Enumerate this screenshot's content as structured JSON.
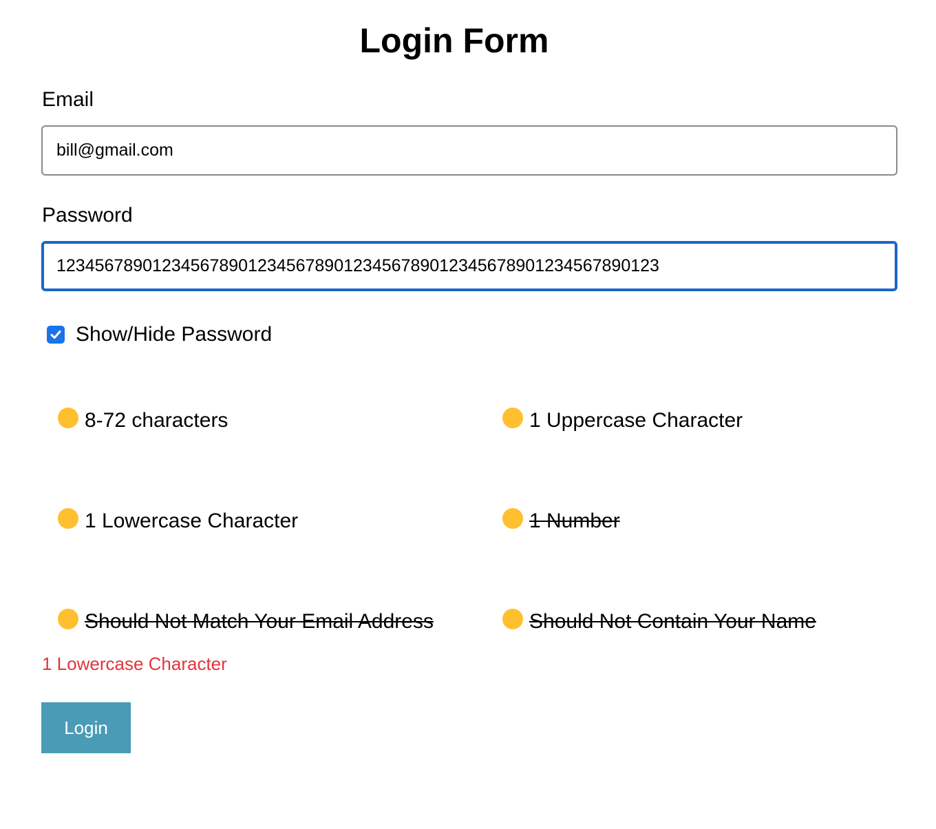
{
  "header": {
    "title": "Login Form"
  },
  "form": {
    "email": {
      "label": "Email",
      "value": "bill@gmail.com"
    },
    "password": {
      "label": "Password",
      "value": "123456789012345678901234567890123456789012345678901234567890123"
    },
    "show_hide": {
      "label": "Show/Hide Password",
      "checked": true
    },
    "rules": [
      {
        "text": "8-72 characters",
        "satisfied": false
      },
      {
        "text": "1 Uppercase Character",
        "satisfied": false
      },
      {
        "text": "1 Lowercase Character",
        "satisfied": false
      },
      {
        "text": "1 Number",
        "satisfied": true
      },
      {
        "text": "Should Not Match Your Email Address",
        "satisfied": true
      },
      {
        "text": "Should Not Contain Your Name",
        "satisfied": true
      }
    ],
    "error": "1 Lowercase Character",
    "submit_label": "Login"
  },
  "colors": {
    "rule_dot": "#ffbf2e",
    "focus_border": "#1a66c9",
    "error_text": "#e0353c",
    "button_bg": "#4a9bb5",
    "checkbox": "#1a73e8"
  }
}
